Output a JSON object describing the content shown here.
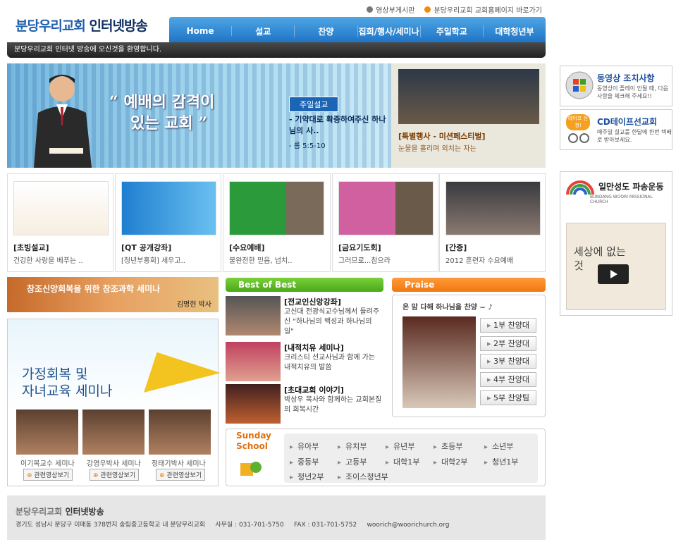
{
  "header": {
    "logo_part1": "분당우리교회",
    "logo_part2": "인터넷방송",
    "toplinks": [
      "영상부게시판",
      "분당우리교회 교회홈페이지 바로가기"
    ],
    "nav": [
      "Home",
      "설교",
      "찬양",
      "집회/행사/세미나",
      "주일학교",
      "대학청년부"
    ],
    "welcome": "분당우리교회 인터넷 방송에 오신것을 환영합니다."
  },
  "banner": {
    "quote_line1": "“ 예배의 감격이",
    "quote_line2": "있는 교회 ”",
    "badge": "주일설교",
    "title": "- 기약대로 확증하여주신 하나님의 사..",
    "ref": "- 롬 5:5-10"
  },
  "event": {
    "title": "[특별행사 - 미션페스티벌]",
    "desc": "눈물을 흘리며 외치는 자는"
  },
  "side": {
    "video_title": "동영상 조치사항",
    "video_desc": "동영상이 플레이 안될 때, 다음사항을 체크해 주세요!!",
    "cd_title": "CD테이프선교회",
    "cd_desc": "매주일 설교를 한달에 한번 택배로 받아보세요.",
    "cd_badge": "테이프 신청!",
    "mission_title": "일만성도 파송운동",
    "mission_sub": "BUNDANG WOORI MISSIONAL CHURCH",
    "book_text": "세상에 없는 것"
  },
  "videos": [
    {
      "cat": "[초빙설교]",
      "desc": "건강한 사랑을 베푸는 .."
    },
    {
      "cat": "[QT 공개강좌]",
      "desc": "[청년부홍회] 세우고.."
    },
    {
      "cat": "[수요예배]",
      "desc": "불완전한 믿음, 넘치.."
    },
    {
      "cat": "[금요기도회]",
      "desc": "그러므로...참으라"
    },
    {
      "cat": "[간증]",
      "desc": "2012 훈련자 수요예배"
    }
  ],
  "creation": {
    "title": "창조신앙회복을 위한 창조과학 세미나",
    "speaker": "김명현 박사"
  },
  "family": {
    "title1": "가정회복 및",
    "title2": "자녀교육 세미나",
    "people": [
      {
        "name": "이기복교수 세미나",
        "btn": "관련영상보기"
      },
      {
        "name": "강영우박사 세미나",
        "btn": "관련영상보기"
      },
      {
        "name": "정태기박사 세미나",
        "btn": "관련영상보기"
      }
    ]
  },
  "best": {
    "heading": "Best of Best",
    "items": [
      {
        "title": "[전교인신앙강좌]",
        "desc": "고신대 전광식교수님께서 들려주신 \"하나님의 백성과 하나님의 일\""
      },
      {
        "title": "[내적치유 세미나]",
        "desc": "크리스티 선교사님과 함께 가는 내적치유의 발씀"
      },
      {
        "title": "[초대교회 이야기]",
        "desc": "박상우 목사와 함께하는 교회본질의 회복시간"
      }
    ]
  },
  "praise": {
    "heading": "Praise",
    "sub": "온 맘 다해 하나님을 찬양 ~ ♪",
    "buttons": [
      "1부 찬양대",
      "2부 찬양대",
      "3부 찬양대",
      "4부 찬양대",
      "5부 찬양팀"
    ]
  },
  "sunday": {
    "logo1": "Sunday",
    "logo2": "School",
    "links": [
      "유아부",
      "유치부",
      "유년부",
      "초등부",
      "소년부",
      "중등부",
      "고등부",
      "대학1부",
      "대학2부",
      "청년1부",
      "청년2부",
      "조이스청년부"
    ]
  },
  "footer": {
    "title1": "분당우리교회",
    "title2": "인터넷방송",
    "info": "경기도 성남시 분당구 이매동 378번지 송림중고등학교 내 분당우리교회     사무실 : 031-701-5750     FAX : 031-701-5752     woorich@woorichurch.org"
  }
}
